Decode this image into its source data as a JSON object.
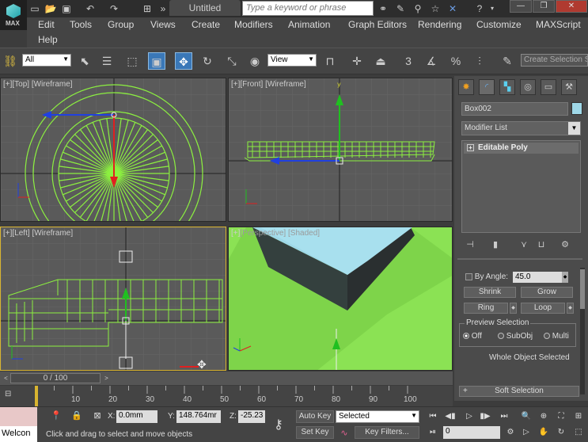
{
  "app": {
    "logo_text": "MAX",
    "doc_title": "Untitled",
    "search_placeholder": "Type a keyword or phrase"
  },
  "menu": [
    "Edit",
    "Tools",
    "Group",
    "Views",
    "Create",
    "Modifiers",
    "Animation",
    "Graph Editors",
    "Rendering",
    "Customize",
    "MAXScript",
    "Help"
  ],
  "toolbar": {
    "selection_filter": "All",
    "ref_coord": "View",
    "create_selection_set": "Create Selection Se",
    "snap_label": "3",
    "percent_label": "%"
  },
  "viewports": {
    "top": {
      "bracket": "[+]",
      "view": "[Top]",
      "shading": "[Wireframe]"
    },
    "front": {
      "bracket": "[+]",
      "view": "[Front]",
      "shading": "[Wireframe]"
    },
    "left": {
      "bracket": "[+]",
      "view": "[Left]",
      "shading": "[Wireframe]"
    },
    "persp": {
      "bracket": "[+]",
      "view": "[Perspective]",
      "shading": "[Shaded]"
    }
  },
  "command_panel": {
    "object_name": "Box002",
    "object_color": "#9fd8e8",
    "modifier_list": "Modifier List",
    "stack_item": "Editable Poly",
    "by_angle_label": "By Angle:",
    "by_angle_value": "45.0",
    "shrink": "Shrink",
    "grow": "Grow",
    "ring": "Ring",
    "loop": "Loop",
    "preview_title": "Preview Selection",
    "preview_off": "Off",
    "preview_subobj": "SubObj",
    "preview_multi": "Multi",
    "whole_object": "Whole Object Selected",
    "soft_selection": "Soft Selection"
  },
  "timeslider": {
    "frame_label": "0 / 100",
    "ticks": [
      "10",
      "20",
      "30",
      "40",
      "50",
      "60",
      "70",
      "80",
      "90",
      "100"
    ]
  },
  "status": {
    "welcome": "Welcon",
    "hint": "Click and drag to select and move objects",
    "x_label": "X:",
    "x_value": "0.0mm",
    "y_label": "Y:",
    "y_value": "148.764mr",
    "z_label": "Z:",
    "z_value": "-25.23",
    "auto_key": "Auto Key",
    "set_key": "Set Key",
    "key_filters": "Key Filters...",
    "selected": "Selected",
    "current_frame": "0"
  }
}
